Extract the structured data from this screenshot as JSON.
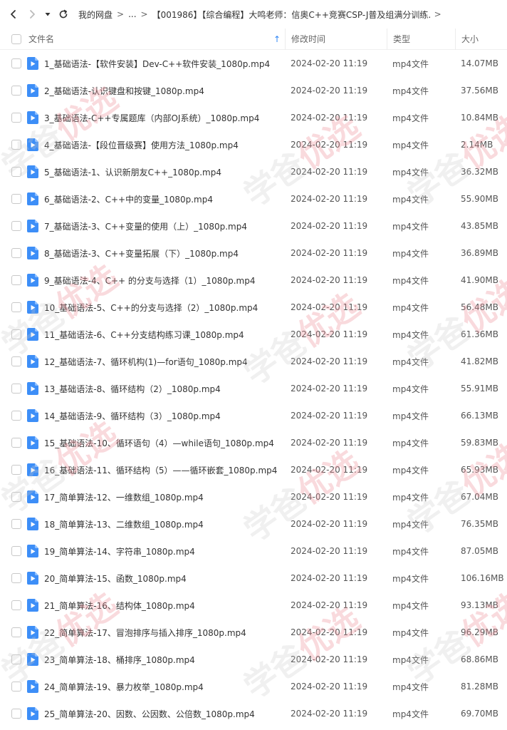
{
  "breadcrumb": {
    "root": "我的网盘",
    "ellipsis": "...",
    "current": "【001986】【综合编程】大鸣老师：信奥C++竞赛CSP-J普及组满分训练..."
  },
  "columns": {
    "name": "文件名",
    "time": "修改时间",
    "type": "类型",
    "size": "大小"
  },
  "files": [
    {
      "name": "1_基础语法-【软件安装】Dev-C++软件安装_1080p.mp4",
      "time": "2024-02-20 11:19",
      "type": "mp4文件",
      "size": "14.07MB"
    },
    {
      "name": "2_基础语法-认识键盘和按键_1080p.mp4",
      "time": "2024-02-20 11:19",
      "type": "mp4文件",
      "size": "37.56MB"
    },
    {
      "name": "3_基础语法-C++专属题库（内部OJ系统）_1080p.mp4",
      "time": "2024-02-20 11:19",
      "type": "mp4文件",
      "size": "10.84MB"
    },
    {
      "name": "4_基础语法-【段位晋级赛】使用方法_1080p.mp4",
      "time": "2024-02-20 11:19",
      "type": "mp4文件",
      "size": "2.14MB"
    },
    {
      "name": "5_基础语法-1、认识新朋友C++_1080p.mp4",
      "time": "2024-02-20 11:19",
      "type": "mp4文件",
      "size": "36.32MB"
    },
    {
      "name": "6_基础语法-2、C++中的变量_1080p.mp4",
      "time": "2024-02-20 11:19",
      "type": "mp4文件",
      "size": "55.90MB"
    },
    {
      "name": "7_基础语法-3、C++变量的使用（上）_1080p.mp4",
      "time": "2024-02-20 11:19",
      "type": "mp4文件",
      "size": "43.85MB"
    },
    {
      "name": "8_基础语法-3、C++变量拓展（下）_1080p.mp4",
      "time": "2024-02-20 11:19",
      "type": "mp4文件",
      "size": "36.89MB"
    },
    {
      "name": "9_基础语法-4、C++ 的分支与选择（1）_1080p.mp4",
      "time": "2024-02-20 11:19",
      "type": "mp4文件",
      "size": "41.90MB"
    },
    {
      "name": "10_基础语法-5、C++的分支与选择（2）_1080p.mp4",
      "time": "2024-02-20 11:19",
      "type": "mp4文件",
      "size": "56.48MB"
    },
    {
      "name": "11_基础语法-6、C++分支结构练习课_1080p.mp4",
      "time": "2024-02-20 11:19",
      "type": "mp4文件",
      "size": "61.36MB"
    },
    {
      "name": "12_基础语法-7、循环机构(1)—for语句_1080p.mp4",
      "time": "2024-02-20 11:19",
      "type": "mp4文件",
      "size": "41.82MB"
    },
    {
      "name": "13_基础语法-8、循环结构（2）_1080p.mp4",
      "time": "2024-02-20 11:19",
      "type": "mp4文件",
      "size": "55.91MB"
    },
    {
      "name": "14_基础语法-9、循环结构（3）_1080p.mp4",
      "time": "2024-02-20 11:19",
      "type": "mp4文件",
      "size": "66.13MB"
    },
    {
      "name": "15_基础语法-10、循环语句（4）—while语句_1080p.mp4",
      "time": "2024-02-20 11:19",
      "type": "mp4文件",
      "size": "59.83MB"
    },
    {
      "name": "16_基础语法-11、循环结构（5）——循环嵌套_1080p.mp4",
      "time": "2024-02-20 11:19",
      "type": "mp4文件",
      "size": "65.93MB"
    },
    {
      "name": "17_简单算法-12、一维数组_1080p.mp4",
      "time": "2024-02-20 11:19",
      "type": "mp4文件",
      "size": "67.04MB"
    },
    {
      "name": "18_简单算法-13、二维数组_1080p.mp4",
      "time": "2024-02-20 11:19",
      "type": "mp4文件",
      "size": "76.35MB"
    },
    {
      "name": "19_简单算法-14、字符串_1080p.mp4",
      "time": "2024-02-20 11:19",
      "type": "mp4文件",
      "size": "87.05MB"
    },
    {
      "name": "20_简单算法-15、函数_1080p.mp4",
      "time": "2024-02-20 11:19",
      "type": "mp4文件",
      "size": "106.16MB"
    },
    {
      "name": "21_简单算法-16、结构体_1080p.mp4",
      "time": "2024-02-20 11:19",
      "type": "mp4文件",
      "size": "93.13MB"
    },
    {
      "name": "22_简单算法-17、冒泡排序与插入排序_1080p.mp4",
      "time": "2024-02-20 11:19",
      "type": "mp4文件",
      "size": "96.29MB"
    },
    {
      "name": "23_简单算法-18、桶排序_1080p.mp4",
      "time": "2024-02-20 11:19",
      "type": "mp4文件",
      "size": "68.86MB"
    },
    {
      "name": "24_简单算法-19、暴力枚举_1080p.mp4",
      "time": "2024-02-20 11:19",
      "type": "mp4文件",
      "size": "81.28MB"
    },
    {
      "name": "25_简单算法-20、因数、公因数、公倍数_1080p.mp4",
      "time": "2024-02-20 11:19",
      "type": "mp4文件",
      "size": "69.70MB"
    }
  ],
  "watermark": {
    "part1": "学爸",
    "part2": "优选"
  },
  "colors": {
    "accent": "#2f86f6",
    "file_icon": "#3d8ef7"
  }
}
